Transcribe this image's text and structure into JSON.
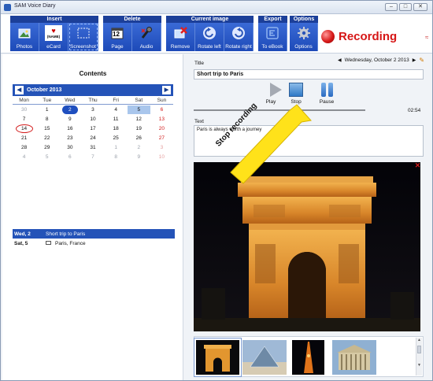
{
  "window": {
    "title": "SAM Voice Diary",
    "controls": [
      "–",
      "□",
      "✕"
    ]
  },
  "toolbar": {
    "groups": [
      {
        "label": "Insert",
        "buttons": [
          {
            "label": "Photos",
            "icon": "photo-icon"
          },
          {
            "label": "eCard",
            "icon": "ecard-icon",
            "icon_text": "(NAME)"
          },
          {
            "label": "Screenshot",
            "icon": "screenshot-icon"
          }
        ]
      },
      {
        "label": "Delete",
        "buttons": [
          {
            "label": "Page",
            "icon": "calendar-page-icon",
            "icon_text": "12"
          },
          {
            "label": "Audio",
            "icon": "audio-icon"
          }
        ]
      },
      {
        "label": "Current image",
        "buttons": [
          {
            "label": "Remove",
            "icon": "remove-icon"
          },
          {
            "label": "Rotate left",
            "icon": "rotate-left-icon"
          },
          {
            "label": "Rotate right",
            "icon": "rotate-right-icon"
          }
        ]
      },
      {
        "label": "Export",
        "buttons": [
          {
            "label": "To eBook",
            "icon": "ebook-icon"
          }
        ]
      },
      {
        "label": "Options",
        "buttons": [
          {
            "label": "Options",
            "icon": "gear-icon"
          }
        ]
      }
    ],
    "status": "Recording",
    "status_color": "#d61616"
  },
  "left": {
    "heading": "Contents",
    "calendar": {
      "month": "October 2013",
      "prev": "◀",
      "next": "▶",
      "weekdays": [
        "Mon",
        "Tue",
        "Wed",
        "Thu",
        "Fri",
        "Sat",
        "Sun"
      ],
      "weeks": [
        [
          "30",
          "1",
          "2",
          "3",
          "4",
          "5",
          "6"
        ],
        [
          "7",
          "8",
          "9",
          "10",
          "11",
          "12",
          "13"
        ],
        [
          "14",
          "15",
          "16",
          "17",
          "18",
          "19",
          "20"
        ],
        [
          "21",
          "22",
          "23",
          "24",
          "25",
          "26",
          "27"
        ],
        [
          "28",
          "29",
          "30",
          "31",
          "1",
          "2",
          "3"
        ],
        [
          "4",
          "5",
          "6",
          "7",
          "8",
          "9",
          "10"
        ]
      ],
      "selected_day": "2",
      "circled_day": "14",
      "highlighted_day": "5"
    },
    "entries": [
      {
        "date": "Wed, 2",
        "title": "Short trip to Paris",
        "selected": true
      },
      {
        "date": "Sat, 5",
        "title": "Paris, France",
        "selected": false
      }
    ]
  },
  "right": {
    "title_label": "Title",
    "date": "Wednesday, October 2 2013",
    "title_value": "Short trip to Paris",
    "media": {
      "play": "Play",
      "stop": "Stop",
      "pause": "Pause"
    },
    "elapsed": "02:54",
    "text_label": "Text",
    "text_value": "Paris is always worth a journey",
    "callout": "Stop recording"
  }
}
